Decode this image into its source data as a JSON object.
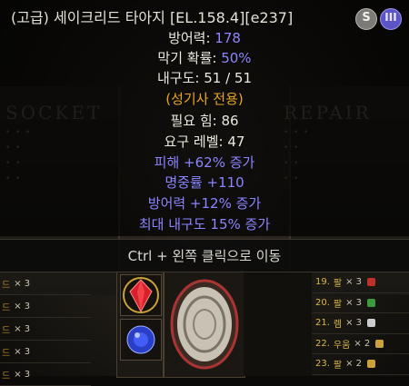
{
  "tooltip": {
    "title": "(고급) 세이크리드 타아지 [EL.158.4][e237]",
    "badge_s": "S",
    "badge_m": "III",
    "defense_label": "방어력: ",
    "defense_value": "178",
    "block_label": "막기 확률: ",
    "block_value": "50%",
    "durability": "내구도: 51 / 51",
    "class_only": "(성기사 전용)",
    "req_str": "필요 힘: 86",
    "req_level": "요구 레벨: 47",
    "mods": [
      "피해 +62% 증가",
      "명중률 +110",
      "방어력 +12% 증가",
      "최대 내구도 15% 증가"
    ]
  },
  "hint": {
    "text": "Ctrl + 왼쪽 클릭으로 이동"
  },
  "colors": {
    "defense_value": "#8d86ff",
    "magic_mod": "#8a84ff",
    "class_only": "#e8a521",
    "rune_name": "#d8b84a"
  },
  "left_list": [
    {
      "name": "드",
      "count": "× 3"
    },
    {
      "name": "드",
      "count": "× 3"
    },
    {
      "name": "드",
      "count": "× 3"
    },
    {
      "name": "드",
      "count": "× 3"
    },
    {
      "name": "드",
      "count": "× 3"
    }
  ],
  "right_list": [
    {
      "num": "19.",
      "name": "팔",
      "count": "× 3",
      "gem": "#c0302a"
    },
    {
      "num": "20.",
      "name": "팔",
      "count": "× 3",
      "gem": "#3a9a3c"
    },
    {
      "num": "21.",
      "name": "렘",
      "count": "× 3",
      "gem": "#cccccc"
    },
    {
      "num": "22.",
      "name": "우움",
      "count": "× 2",
      "gem": "#c9a33a"
    },
    {
      "num": "23.",
      "name": "팔",
      "count": "× 2",
      "gem": "#c9a33a"
    }
  ]
}
